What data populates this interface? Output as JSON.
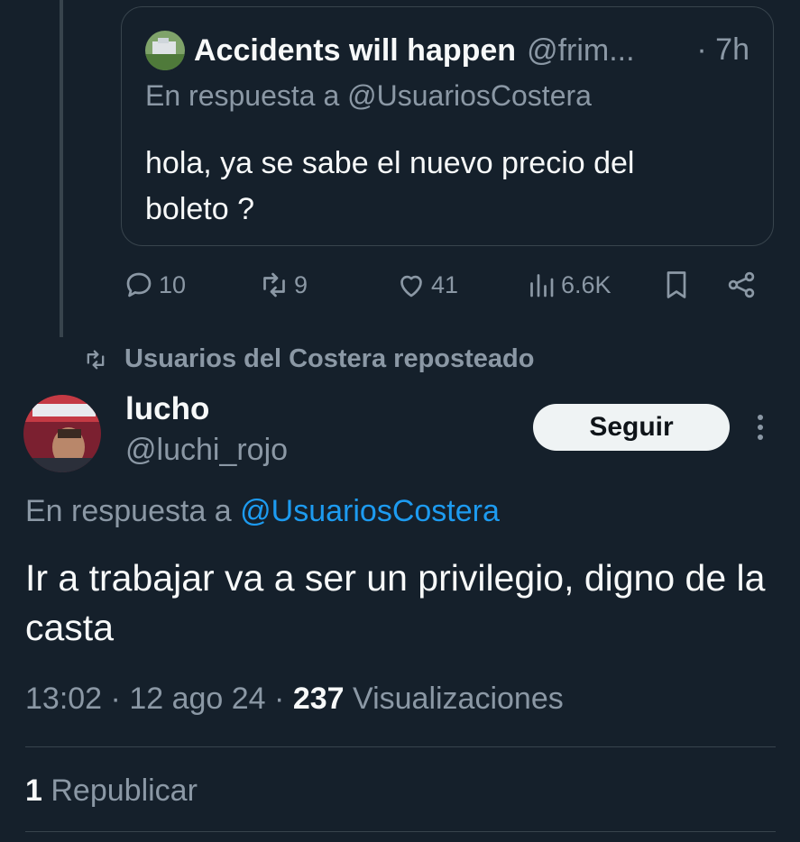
{
  "quoted_tweet": {
    "author_name": "Accidents will happen",
    "author_handle": "@frim...",
    "time": "· 7h",
    "reply_prefix": "En respuesta a",
    "reply_mention": "@UsuariosCostera",
    "text": "hola, ya se sabe el nuevo precio del boleto ?",
    "actions": {
      "replies": "10",
      "reposts": "9",
      "likes": "41",
      "views": "6.6K"
    }
  },
  "repost_banner": "Usuarios del Costera reposteado",
  "tweet": {
    "author_name": "lucho",
    "author_handle": "@luchi_rojo",
    "follow_label": "Seguir",
    "reply_prefix": "En respuesta a",
    "reply_mention": "@UsuariosCostera",
    "text": "Ir a trabajar va a ser un privilegio, digno de la casta",
    "time": "13:02",
    "date": "12 ago 24",
    "views_count": "237",
    "views_label": "Visualizaciones",
    "reposts_count": "1",
    "reposts_label": "Republicar"
  },
  "colors": {
    "background": "#15202b",
    "text": "#f7f9f9",
    "muted": "#8b98a5",
    "link": "#1d9bf0",
    "border": "#38444d"
  },
  "icons": [
    "reply-icon",
    "repost-icon",
    "like-icon",
    "views-icon",
    "bookmark-icon",
    "share-icon",
    "more-icon"
  ]
}
